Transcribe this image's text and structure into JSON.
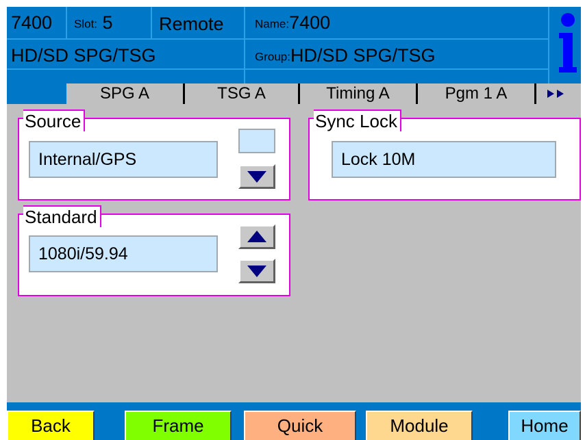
{
  "header": {
    "model": "7400",
    "slot_label": "Slot:",
    "slot_value": "5",
    "mode": "Remote",
    "name_label": "Name:",
    "name_value": "7400",
    "card_type": "HD/SD SPG/TSG",
    "group_label": "Group:",
    "group_value": "HD/SD SPG/TSG",
    "info_icon": "info-icon"
  },
  "tabs": [
    {
      "label": "SPG A"
    },
    {
      "label": "TSG A"
    },
    {
      "label": "Timing A"
    },
    {
      "label": "Pgm 1 A"
    }
  ],
  "tabs_more_icon": "double-right-arrow-icon",
  "source": {
    "title": "Source",
    "value": "Internal/GPS"
  },
  "sync_lock": {
    "title": "Sync Lock",
    "value": "Lock 10M"
  },
  "standard": {
    "title": "Standard",
    "value": "1080i/59.94"
  },
  "footer": {
    "back": "Back",
    "frame": "Frame",
    "quick": "Quick",
    "module": "Module",
    "home": "Home"
  },
  "colors": {
    "header_blue": "#0078c8",
    "panel_gray": "#c0c0c0",
    "group_border": "#e000e0",
    "value_bg": "#cce8ff",
    "arrow_navy": "#000080",
    "back_btn": "#ffff00",
    "frame_btn": "#80ff00",
    "quick_btn": "#ffb080",
    "module_btn": "#ffd890",
    "home_btn": "#80d8ff"
  }
}
